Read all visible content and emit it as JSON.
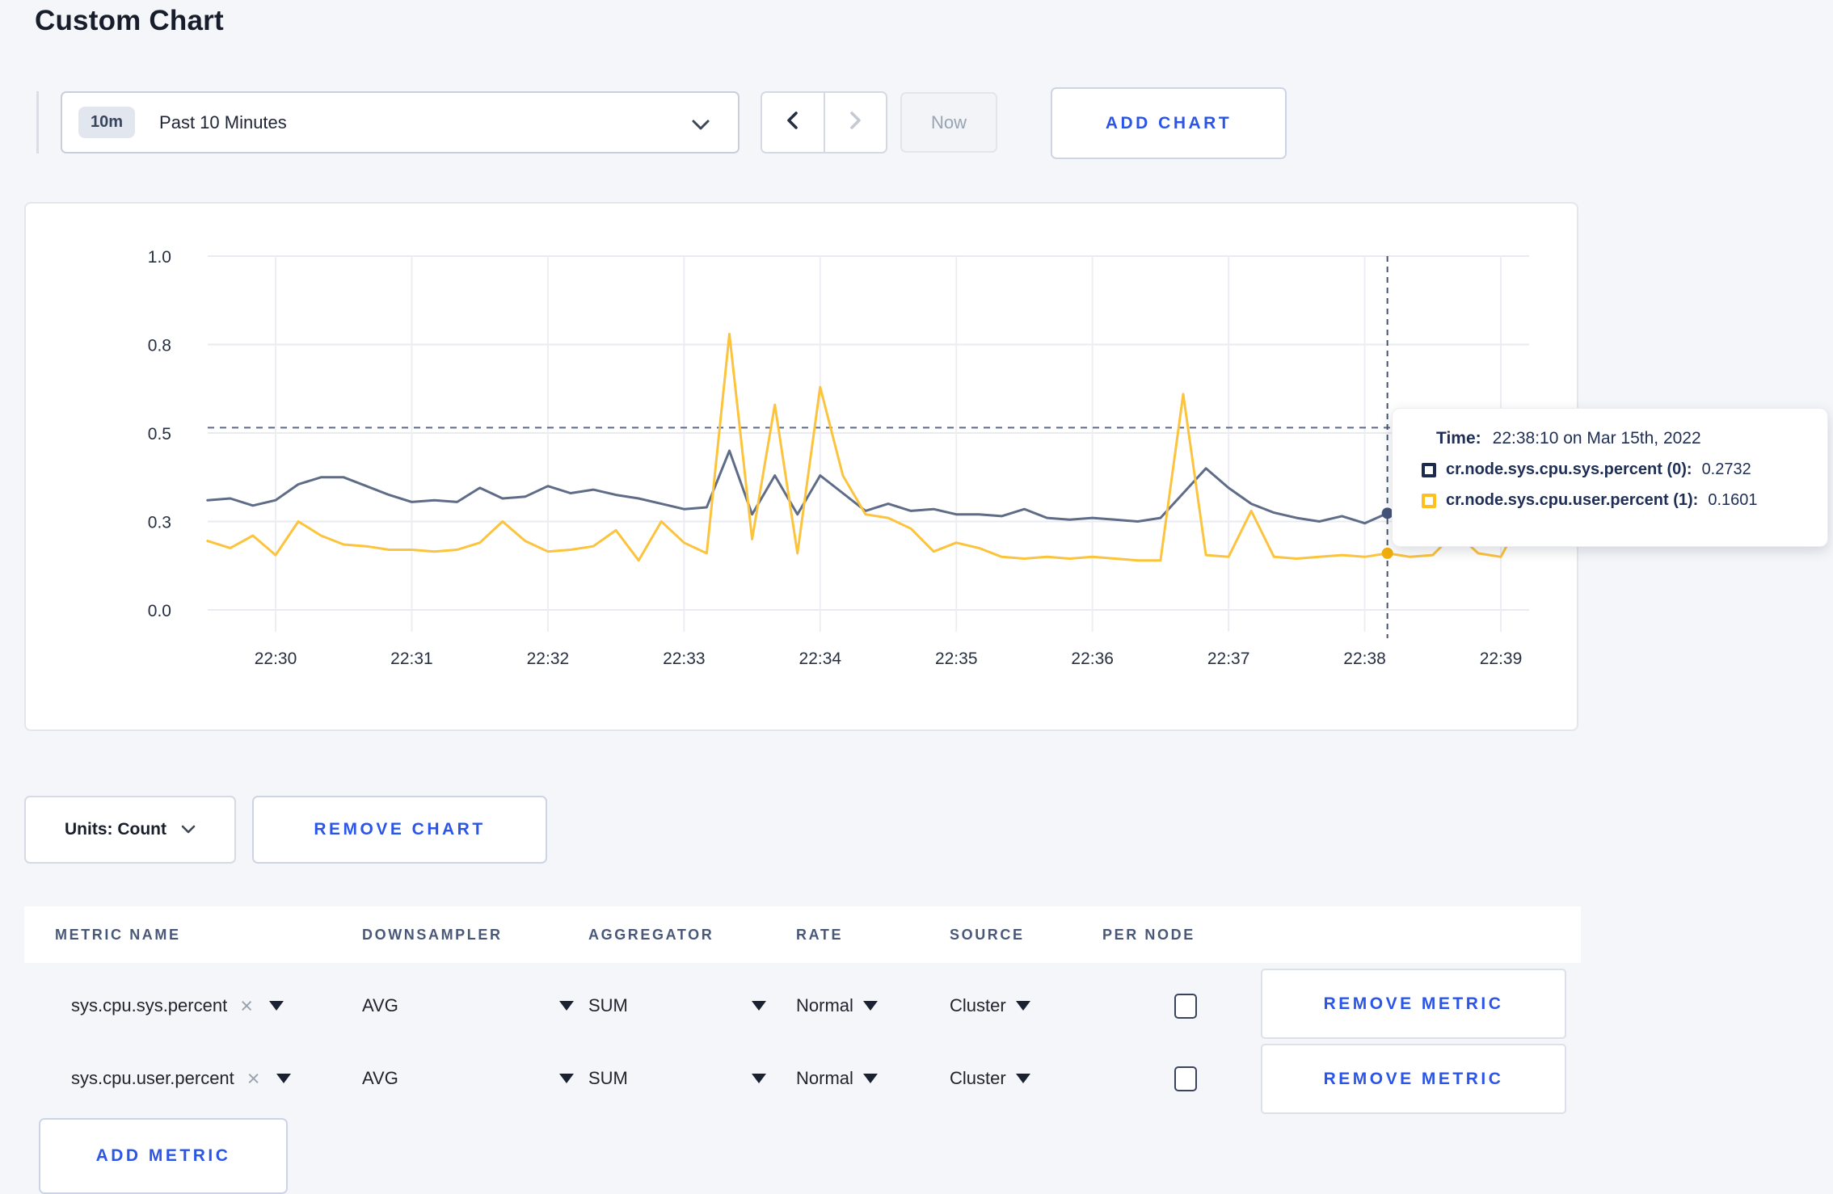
{
  "page": {
    "title": "Custom Chart"
  },
  "toolbar": {
    "time_range": {
      "badge": "10m",
      "label": "Past 10 Minutes"
    },
    "prev_icon": "chevron-left",
    "next_icon": "chevron-right",
    "now_label": "Now",
    "add_chart_label": "ADD CHART"
  },
  "chart_data": {
    "type": "line",
    "title": "",
    "xlabel": "",
    "ylabel": "",
    "ylim": [
      0,
      1
    ],
    "grid": true,
    "legend_position": "none",
    "x_start_time": "22:29:30",
    "interval_seconds": 10,
    "x_ticks": [
      {
        "label": "22:30",
        "t": 30
      },
      {
        "label": "22:31",
        "t": 90
      },
      {
        "label": "22:32",
        "t": 150
      },
      {
        "label": "22:33",
        "t": 210
      },
      {
        "label": "22:34",
        "t": 270
      },
      {
        "label": "22:35",
        "t": 330
      },
      {
        "label": "22:36",
        "t": 390
      },
      {
        "label": "22:37",
        "t": 450
      },
      {
        "label": "22:38",
        "t": 510
      },
      {
        "label": "22:39",
        "t": 570
      }
    ],
    "y_ticks": [
      {
        "label": "1.0",
        "value": 1.0
      },
      {
        "label": "0.8",
        "value": 0.75
      },
      {
        "label": "0.5",
        "value": 0.5
      },
      {
        "label": "0.3",
        "value": 0.25
      },
      {
        "label": "0.0",
        "value": 0.0
      }
    ],
    "threshold_value": 0.515,
    "series": [
      {
        "name": "cr.node.sys.cpu.sys.percent",
        "color": "#5f6c87",
        "dot_color": "#44557a",
        "values": [
          0.31,
          0.315,
          0.295,
          0.31,
          0.355,
          0.375,
          0.375,
          0.35,
          0.325,
          0.305,
          0.31,
          0.305,
          0.345,
          0.315,
          0.32,
          0.35,
          0.33,
          0.34,
          0.325,
          0.315,
          0.3,
          0.285,
          0.29,
          0.45,
          0.27,
          0.38,
          0.27,
          0.38,
          0.33,
          0.28,
          0.3,
          0.28,
          0.285,
          0.27,
          0.27,
          0.265,
          0.285,
          0.26,
          0.255,
          0.26,
          0.255,
          0.25,
          0.26,
          0.33,
          0.4,
          0.345,
          0.3,
          0.275,
          0.26,
          0.25,
          0.265,
          0.245,
          0.2732,
          0.255,
          0.265,
          0.27,
          0.26,
          0.265,
          0.3
        ]
      },
      {
        "name": "cr.node.sys.cpu.user.percent",
        "color": "#fcc33c",
        "dot_color": "#f0ad0c",
        "values": [
          0.195,
          0.175,
          0.21,
          0.155,
          0.25,
          0.21,
          0.185,
          0.18,
          0.17,
          0.17,
          0.165,
          0.17,
          0.19,
          0.25,
          0.195,
          0.165,
          0.17,
          0.18,
          0.225,
          0.14,
          0.25,
          0.19,
          0.16,
          0.78,
          0.2,
          0.58,
          0.16,
          0.63,
          0.38,
          0.27,
          0.26,
          0.23,
          0.165,
          0.19,
          0.175,
          0.15,
          0.145,
          0.15,
          0.145,
          0.15,
          0.145,
          0.14,
          0.14,
          0.61,
          0.155,
          0.15,
          0.28,
          0.15,
          0.145,
          0.15,
          0.155,
          0.15,
          0.1601,
          0.15,
          0.155,
          0.22,
          0.16,
          0.15,
          0.27
        ]
      }
    ],
    "hover": {
      "t": 520,
      "time": "22:38:10",
      "values": [
        0.2732,
        0.1601
      ]
    }
  },
  "tooltip": {
    "time_label": "Time:",
    "time_value": "22:38:10 on Mar 15th, 2022",
    "series": [
      {
        "name": "cr.node.sys.cpu.sys.percent (0):",
        "value": "0.2732",
        "swatch_color": "#1c2b4d"
      },
      {
        "name": "cr.node.sys.cpu.user.percent (1):",
        "value": "0.1601",
        "swatch_color": "#ffbf1c"
      }
    ]
  },
  "chart_footer": {
    "units_label": "Units: Count",
    "remove_chart_label": "REMOVE CHART"
  },
  "metrics_table": {
    "headers": [
      "METRIC NAME",
      "DOWNSAMPLER",
      "AGGREGATOR",
      "RATE",
      "SOURCE",
      "PER NODE"
    ],
    "rows": [
      {
        "metric_name": "sys.cpu.sys.percent",
        "downsampler": "AVG",
        "aggregator": "SUM",
        "rate": "Normal",
        "source": "Cluster",
        "per_node_checked": false,
        "remove_label": "REMOVE METRIC"
      },
      {
        "metric_name": "sys.cpu.user.percent",
        "downsampler": "AVG",
        "aggregator": "SUM",
        "rate": "Normal",
        "source": "Cluster",
        "per_node_checked": false,
        "remove_label": "REMOVE METRIC"
      }
    ],
    "add_metric_label": "ADD METRIC"
  }
}
